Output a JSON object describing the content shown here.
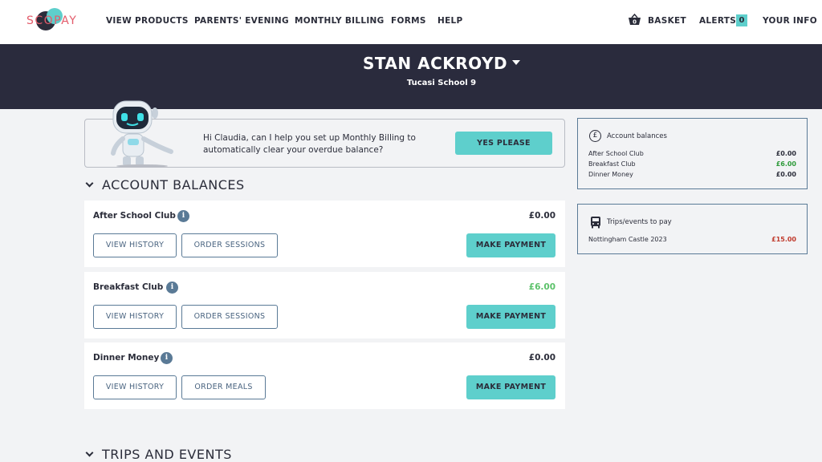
{
  "brand": {
    "logo_text": "SCOPAY"
  },
  "nav": {
    "items": [
      "VIEW PRODUCTS",
      "PARENTS' EVENING",
      "MONTHLY BILLING",
      "FORMS",
      "HELP"
    ],
    "basket_label": "BASKET",
    "basket_count": "0",
    "alerts_label": "ALERTS",
    "alerts_count": "0",
    "your_info_label": "YOUR INFO"
  },
  "header": {
    "student_name": "STAN ACKROYD",
    "school_name": "Tucasi School 9"
  },
  "promo": {
    "message": "Hi Claudia, can I help you set up Monthly Billing to automatically clear your overdue balance?",
    "button_label": "YES PLEASE"
  },
  "sections": {
    "account_balances": "ACCOUNT BALANCES",
    "trips_and_events": "TRIPS AND EVENTS"
  },
  "balances": [
    {
      "name": "After School Club",
      "amount": "£0.00",
      "status": "zero",
      "history_label": "VIEW HISTORY",
      "order_label": "ORDER SESSIONS",
      "pay_label": "MAKE PAYMENT"
    },
    {
      "name": "Breakfast Club",
      "amount": "£6.00",
      "status": "credit",
      "history_label": "VIEW HISTORY",
      "order_label": "ORDER SESSIONS",
      "pay_label": "MAKE PAYMENT"
    },
    {
      "name": "Dinner Money",
      "amount": "£0.00",
      "status": "zero",
      "history_label": "VIEW HISTORY",
      "order_label": "ORDER MEALS",
      "pay_label": "MAKE PAYMENT"
    }
  ],
  "account_panel": {
    "title": "Account balances",
    "icon": "pound-icon",
    "rows": [
      {
        "label": "After School Club",
        "value": "£0.00",
        "color": "#2b2d3a"
      },
      {
        "label": "Breakfast Club",
        "value": "£6.00",
        "color": "#2e9a3a"
      },
      {
        "label": "Dinner Money",
        "value": "£0.00",
        "color": "#2b2d3a"
      }
    ]
  },
  "trips_panel": {
    "title": "Trips/events to pay",
    "icon": "bus-icon",
    "rows": [
      {
        "label": "Nottingham Castle 2023",
        "value": "£15.00",
        "color": "#c0392b"
      }
    ]
  },
  "colors": {
    "accent": "#5ecfcc",
    "header_bg": "#2a2b3d",
    "credit": "#5cc26a",
    "due": "#c0392b",
    "brand_red": "#e35c6b"
  }
}
